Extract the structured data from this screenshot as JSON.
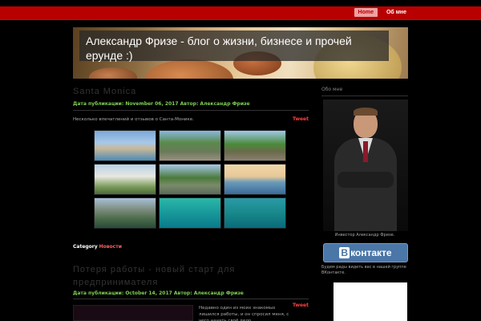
{
  "nav": {
    "items": [
      "Home",
      "Об мне"
    ],
    "active": 0
  },
  "header": {
    "title": "Александр Фризе - блог о жизни, бизнесе и прочей ерунде :)"
  },
  "post1": {
    "title": "Santa Monica",
    "meta": "Дата публикации: November 06, 2017 Автор: Александр Фризе",
    "excerpt": "Несколько впечатлений и отзывов о Санта-Монике.",
    "tweet": "Tweet"
  },
  "category": {
    "label": "Category",
    "value": "Новости"
  },
  "post2": {
    "title": "Потеря работы - новый старт для предпринимателя",
    "meta": "Дата публикации: October 14, 2017 Автор: Александр Фризе",
    "excerpt": "Недавно один из моих знакомых лишился работы, и он спросил меня, с чего начать своё дело.",
    "tweet": "Tweet"
  },
  "sidebar": {
    "title": "Обо мне",
    "caption": "Инвестор Александр Фризе.",
    "vk_label": "контакте",
    "vk_text": "Будем рады видеть вас в нашей группе ВКонтакте."
  }
}
